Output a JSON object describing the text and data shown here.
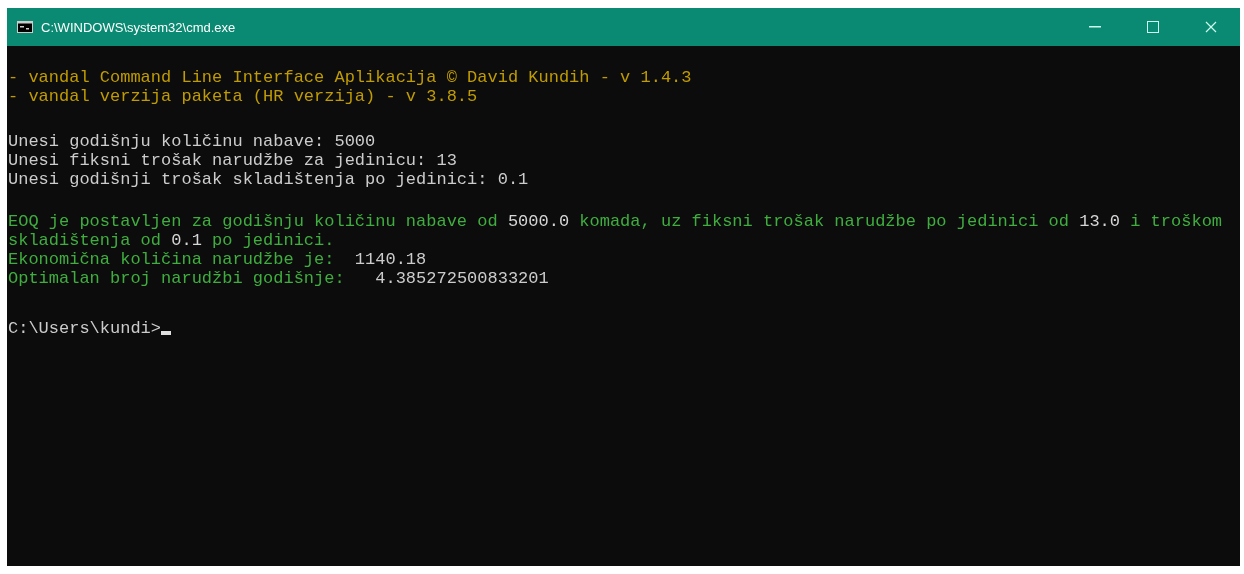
{
  "window": {
    "title": "C:\\WINDOWS\\system32\\cmd.exe"
  },
  "header_lines": [
    "- vandal Command Line Interface Aplikacija © David Kundih - v 1.4.3",
    "- vandal verzija paketa (HR verzija) - v 3.8.5"
  ],
  "input_lines": [
    {
      "label": "Unesi godišnju količinu nabave: ",
      "value": "5000"
    },
    {
      "label": "Unesi fiksni trošak narudžbe za jedinicu: ",
      "value": "13"
    },
    {
      "label": "Unesi godišnji trošak skladištenja po jedinici: ",
      "value": "0.1"
    }
  ],
  "summary": [
    {
      "kind": "text",
      "text": "EOQ je postavljen za godišnju količinu nabave od "
    },
    {
      "kind": "value",
      "text": "5000.0"
    },
    {
      "kind": "text",
      "text": " komada, uz fiksni trošak narudžbe po jedinici od "
    },
    {
      "kind": "value",
      "text": "13.0"
    },
    {
      "kind": "text",
      "text": " i troškom skladištenja od "
    },
    {
      "kind": "value",
      "text": "0.1"
    },
    {
      "kind": "text",
      "text": " po jedinici."
    }
  ],
  "results": [
    {
      "label": "Ekonomična količina narudžbe je:  ",
      "value": "1140.18"
    },
    {
      "label": "Optimalan broj narudžbi godišnje:   ",
      "value": "4.385272500833201"
    }
  ],
  "prompt": "C:\\Users\\kundi>"
}
